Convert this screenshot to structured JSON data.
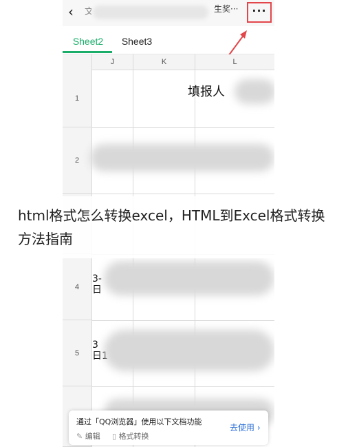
{
  "topbar": {
    "back_icon": "chevron-left-icon",
    "title_prefix": "文",
    "title_suffix": "生奖···",
    "more_label": "···"
  },
  "tabs": [
    {
      "label": "Sheet2",
      "active": true
    },
    {
      "label": "Sheet3",
      "active": false
    }
  ],
  "grid": {
    "columns": [
      "J",
      "K",
      "L"
    ],
    "rows": [
      "1",
      "2",
      "4",
      "5"
    ],
    "cell_l1": "填报人",
    "cell_j4": "3-\n日",
    "cell_j5": "3\n日1"
  },
  "overlay": {
    "caption": "html格式怎么转换excel，HTML到Excel格式转换方法指南"
  },
  "promo": {
    "message": "通过「QQ浏览器」使用以下文档功能",
    "edit_label": "编辑",
    "convert_label": "格式转换",
    "cta_label": "去使用 ›"
  },
  "colors": {
    "accent": "#1aad6a",
    "highlight_box": "#e2464a",
    "link": "#2b6fd6"
  }
}
